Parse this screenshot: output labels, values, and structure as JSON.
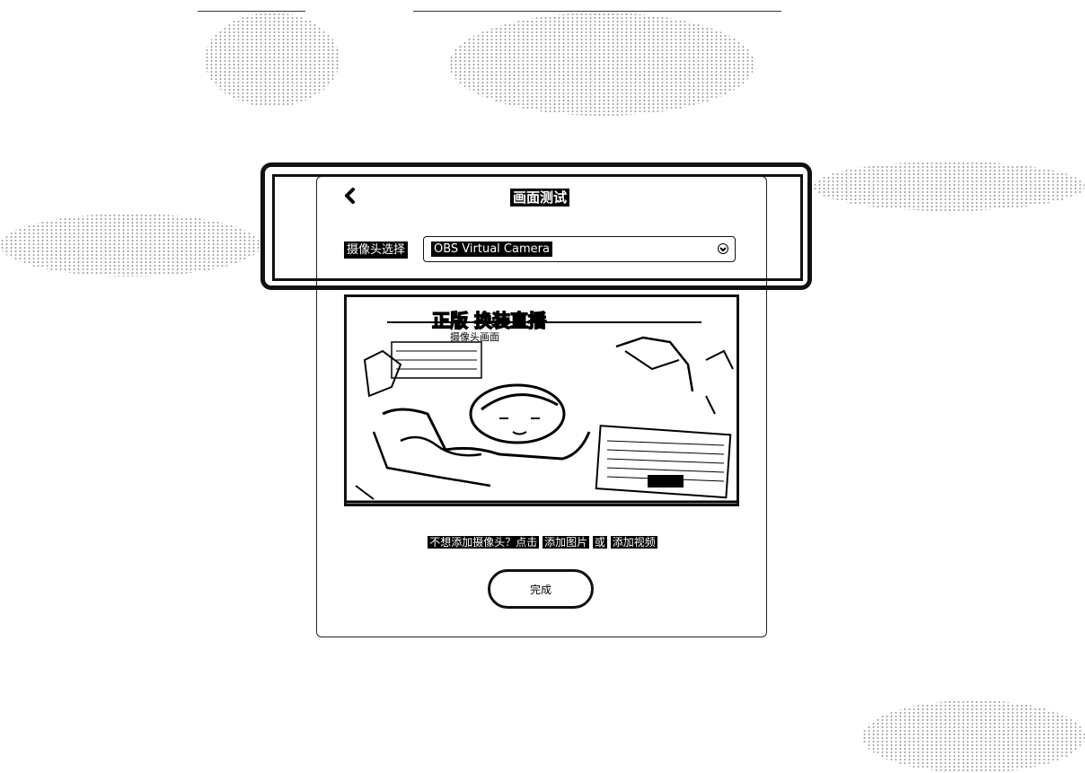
{
  "dialog": {
    "title": "画面测试",
    "back_icon": "chevron-left-icon",
    "camera_label": "摄像头选择",
    "camera_select": {
      "value": "OBS Virtual Camera",
      "icon": "chevron-down-icon"
    },
    "preview": {
      "banner_line1": "正版 换装直播",
      "banner_line2": "摄像头画面"
    },
    "hint": {
      "prefix": "不想添加摄像头？点击",
      "add_image": "添加图片",
      "or": "或",
      "add_video": "添加视频"
    },
    "confirm_label": "完成"
  },
  "colors": {
    "foreground": "#000000",
    "background": "#ffffff"
  }
}
